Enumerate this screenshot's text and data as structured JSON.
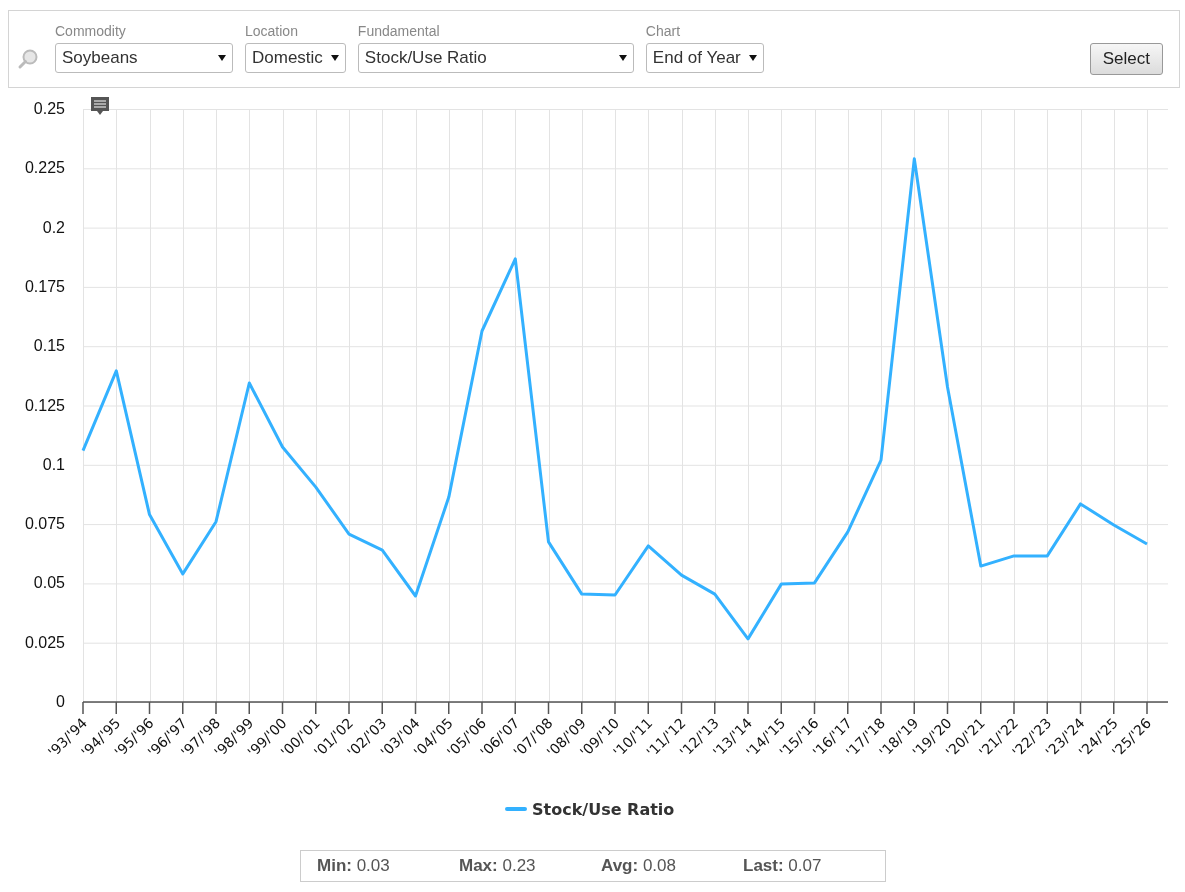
{
  "filters": [
    {
      "label": "Commodity",
      "value": "Soybeans",
      "kind": "wide"
    },
    {
      "label": "Location",
      "value": "Domestic",
      "kind": "narrow"
    },
    {
      "label": "Fundamental",
      "value": "Stock/Use Ratio",
      "kind": "wider"
    },
    {
      "label": "Chart",
      "value": "End of Year",
      "kind": "narrow"
    }
  ],
  "select_button": "Select",
  "chart": {
    "chart_data": {
      "type": "line",
      "categories": [
        "'93/'94",
        "'94/'95",
        "'95/'96",
        "'96/'97",
        "'97/'98",
        "'98/'99",
        "'99/'00",
        "'00/'01",
        "'01/'02",
        "'02/'03",
        "'03/'04",
        "'04/'05",
        "'05/'06",
        "'06/'07",
        "'07/'08",
        "'08/'09",
        "'09/'10",
        "'10/'11",
        "'11/'12",
        "'12/'13",
        "'13/'14",
        "'14/'15",
        "'15/'16",
        "'16/'17",
        "'17/'18",
        "'18/'19",
        "'19/'20",
        "'20/'21",
        "'21/'22",
        "'22/'23",
        "'23/'24",
        "'24/'25",
        "'25/'26"
      ],
      "series": [
        {
          "name": "Stock/Use Ratio",
          "color": "#33b1ff",
          "values": [
            0.106,
            0.1396,
            0.079,
            0.054,
            0.076,
            0.1345,
            0.1075,
            0.0906,
            0.0708,
            0.064,
            0.0447,
            0.0864,
            0.1564,
            0.1868,
            0.0675,
            0.0455,
            0.0451,
            0.0658,
            0.0535,
            0.0455,
            0.0266,
            0.0497,
            0.0502,
            0.0717,
            0.102,
            0.229,
            0.1328,
            0.0573,
            0.0616,
            0.0616,
            0.0835,
            0.0746,
            0.0666
          ]
        }
      ],
      "grid": true,
      "ylim": [
        0,
        0.25
      ],
      "yticks": [
        0,
        0.025,
        0.05,
        0.075,
        0.1,
        0.125,
        0.15,
        0.175,
        0.2,
        0.225,
        0.25
      ]
    }
  },
  "stats": [
    {
      "label": "Min:",
      "value": "0.03"
    },
    {
      "label": "Max:",
      "value": "0.23"
    },
    {
      "label": "Avg:",
      "value": "0.08"
    },
    {
      "label": "Last:",
      "value": "0.07"
    }
  ]
}
